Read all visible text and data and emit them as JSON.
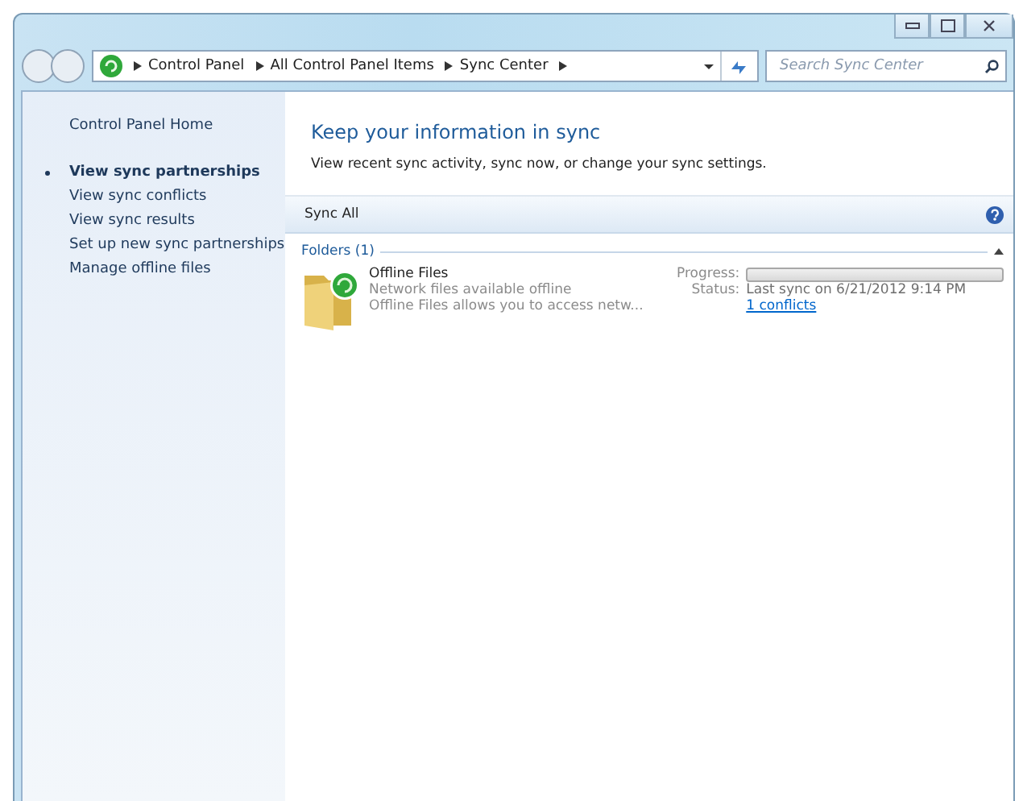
{
  "address_bar": {
    "breadcrumb": [
      "Control Panel",
      "All Control Panel Items",
      "Sync Center"
    ]
  },
  "search": {
    "placeholder": "Search Sync Center"
  },
  "sidebar": {
    "home": "Control Panel Home",
    "items": [
      {
        "label": "View sync partnerships",
        "selected": true
      },
      {
        "label": "View sync conflicts",
        "selected": false
      },
      {
        "label": "View sync results",
        "selected": false
      },
      {
        "label": "Set up new sync partnerships",
        "selected": false
      },
      {
        "label": "Manage offline files",
        "selected": false
      }
    ]
  },
  "header": {
    "title": "Keep your information in sync",
    "description": "View recent sync activity, sync now, or change your sync settings."
  },
  "toolbar": {
    "buttons": [
      "Sync All"
    ]
  },
  "groups": [
    {
      "title": "Folders (1)",
      "expanded": true,
      "items": [
        {
          "name": "Offline Files",
          "subtitle": "Network files available offline",
          "description": "Offline Files allows you to access netw...",
          "progress_label": "Progress:",
          "level": 0,
          "status_label": "Status:",
          "status": "Last sync on 6/21/2012 9:14 PM",
          "link": "1 conflicts"
        }
      ]
    }
  ]
}
